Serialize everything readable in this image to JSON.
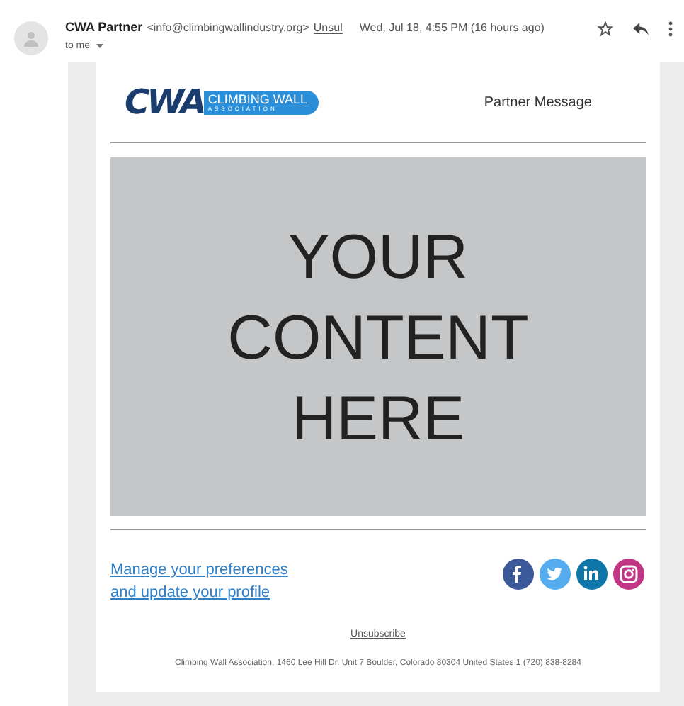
{
  "header": {
    "sender": "CWA Partner",
    "email": "<info@climbingwallindustry.org>",
    "unsubscribe_link": "Unsul",
    "date": "Wed, Jul 18, 4:55 PM (16 hours ago)",
    "recipient": "to me"
  },
  "logo": {
    "mark": "CWA",
    "line_1": "CLIMBING WALL",
    "line_2": "ASSOCIATION"
  },
  "title": "Partner Message",
  "banner": {
    "lines": [
      "YOUR",
      "CONTENT",
      "HERE"
    ]
  },
  "preferences_link": [
    "Manage your preferences",
    "and update your profile"
  ],
  "social": [
    {
      "kind": "facebook",
      "color": "#3b5998"
    },
    {
      "kind": "twitter",
      "color": "#55acee"
    },
    {
      "kind": "linkedin",
      "color": "#0e76a8"
    },
    {
      "kind": "instagram",
      "color": "#c13584"
    }
  ],
  "unsubscribe": "Unsubscribe",
  "address": "Climbing Wall Association, 1460 Lee Hill Dr. Unit 7 Boulder, Colorado 80304 United States 1 (720) 838-8284"
}
